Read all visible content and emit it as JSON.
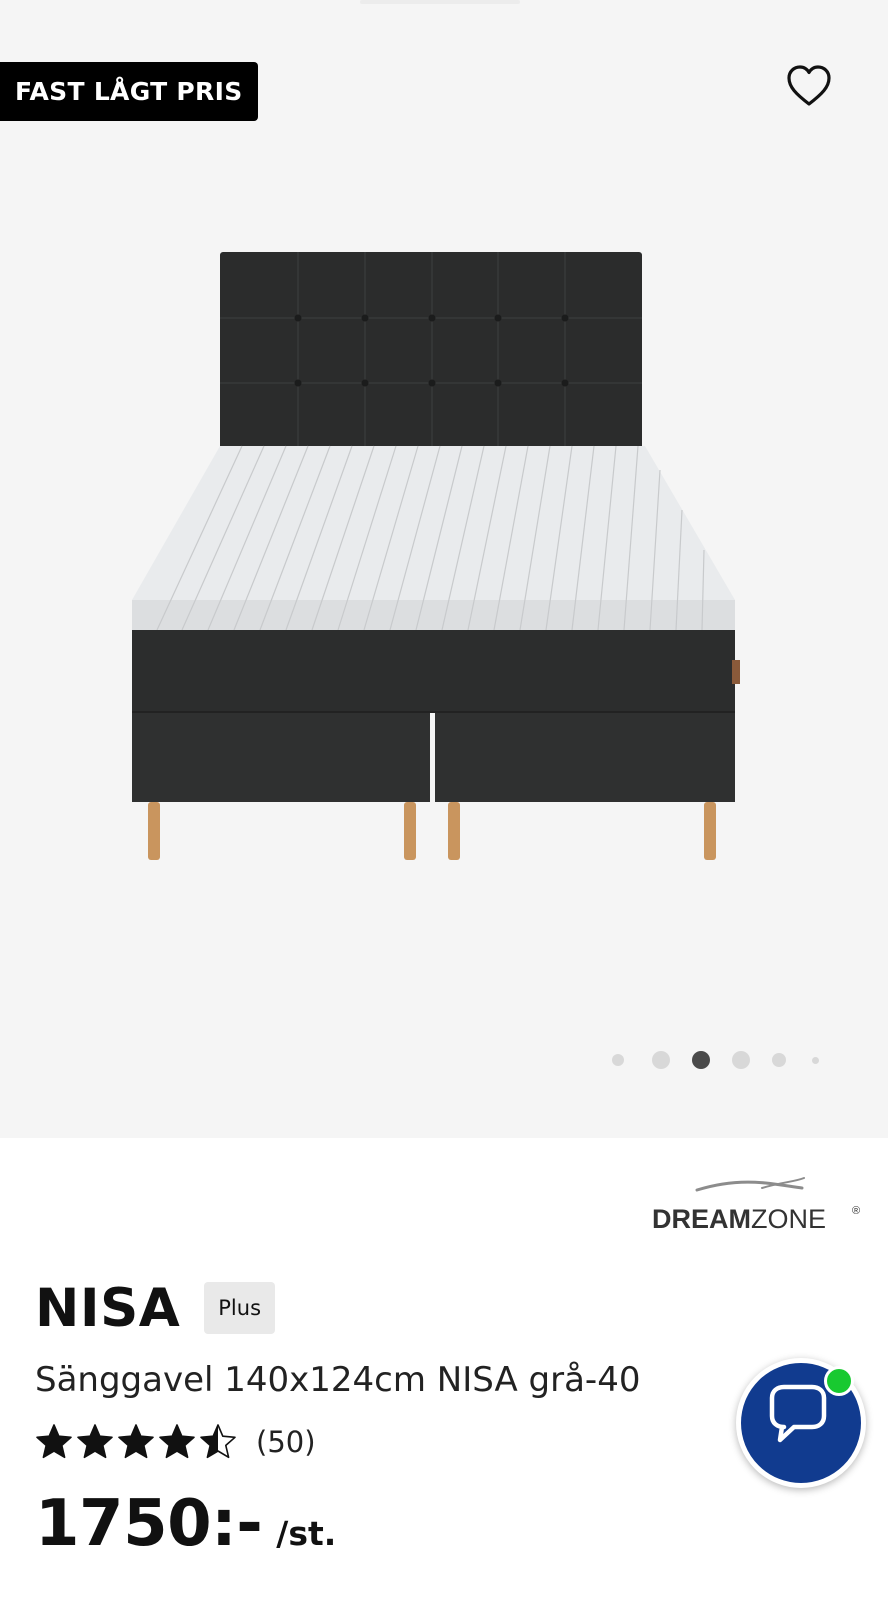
{
  "gallery": {
    "badge_label": "FAST LÅGT PRIS",
    "favorite_icon": "heart-outline-icon",
    "image_alt": "NISA boxspringsäng med sänggavel",
    "pagination": {
      "total": 6,
      "active_index": 2
    },
    "background": "#f5f5f5"
  },
  "brand": {
    "name": "DREAMZONE",
    "registered_mark": "®"
  },
  "product": {
    "name": "NISA",
    "tag": "Plus",
    "subtitle": "Sänggavel 140x124cm NISA grå-40",
    "rating": {
      "value": 4.5,
      "max": 5,
      "count_label": "(50)"
    },
    "price": "1750:-",
    "unit": "/st."
  },
  "chat": {
    "icon": "chat-bubble-icon",
    "status": "online",
    "accent": "#113b8f",
    "status_color": "#18c930"
  }
}
